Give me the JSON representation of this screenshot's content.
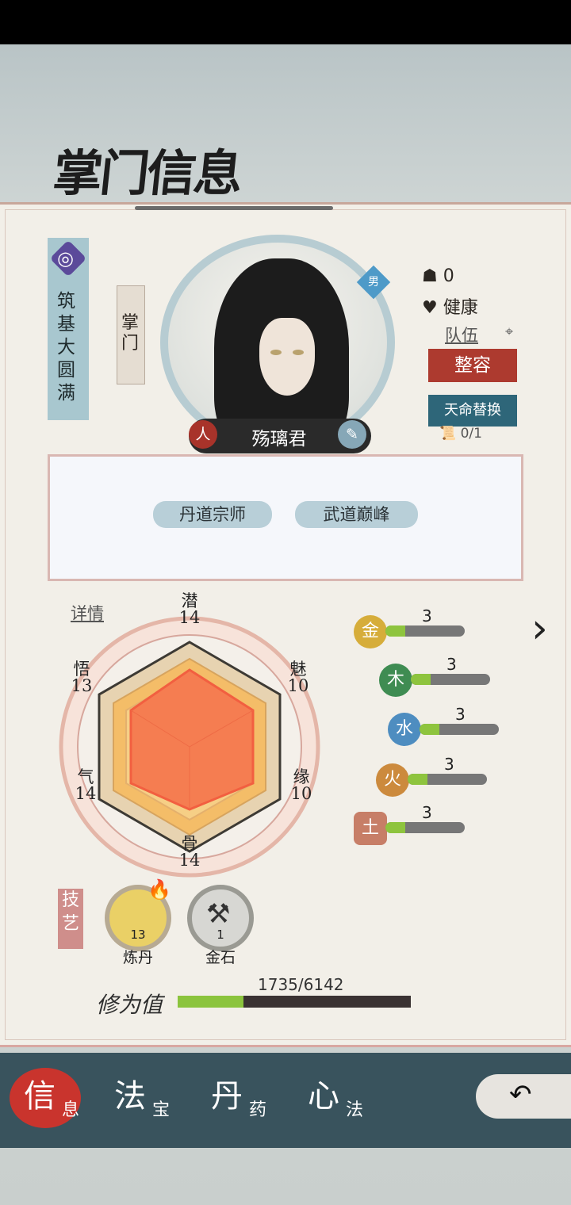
{
  "header": {
    "title": "掌门信息"
  },
  "character": {
    "realm": "筑基大圆满",
    "role": "掌门",
    "gender": "男",
    "name": "殇璃君",
    "name_left_icon": "人",
    "status_count": "0",
    "health": "健康",
    "team_label": "队伍",
    "makeover_button": "整容",
    "fate_replace_button": "天命替换",
    "fate_scroll_count": "0/1"
  },
  "traits": [
    "丹道宗师",
    "武道巅峰"
  ],
  "details_label": "详情",
  "attributes": {
    "潜": "14",
    "魅": "10",
    "缘": "10",
    "骨": "14",
    "气": "14",
    "悟": "13"
  },
  "elements": [
    {
      "name": "金",
      "value": "3",
      "fill": 0.25,
      "color": "#d6ad3a"
    },
    {
      "name": "木",
      "value": "3",
      "fill": 0.25,
      "color": "#3f8c52"
    },
    {
      "name": "水",
      "value": "3",
      "fill": 0.25,
      "color": "#4e8dc0"
    },
    {
      "name": "火",
      "value": "3",
      "fill": 0.25,
      "color": "#cc8a3d"
    },
    {
      "name": "土",
      "value": "3",
      "fill": 0.25,
      "color": "#c77e67"
    }
  ],
  "skills_label": "技艺",
  "skills": [
    {
      "name": "炼丹",
      "level": "13"
    },
    {
      "name": "金石",
      "level": "1"
    }
  ],
  "cultivation": {
    "label": "修为值",
    "value": "1735/6142",
    "progress": 0.282
  },
  "nav": [
    {
      "main": "信",
      "sub": "息"
    },
    {
      "main": "法",
      "sub": "宝"
    },
    {
      "main": "丹",
      "sub": "药"
    },
    {
      "main": "心",
      "sub": "法"
    }
  ],
  "icons": {
    "back": "back-arrow-icon",
    "next": "chevron-right-icon"
  }
}
